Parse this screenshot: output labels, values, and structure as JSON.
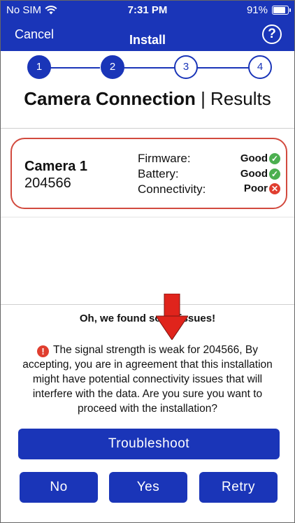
{
  "statusbar": {
    "carrier": "No SIM",
    "time": "7:31 PM",
    "battery": "91%"
  },
  "nav": {
    "cancel_label": "Cancel",
    "title": "Install",
    "help_label": "?"
  },
  "stepper": {
    "steps": [
      "1",
      "2",
      "3",
      "4"
    ],
    "active_step": 2
  },
  "screen": {
    "title_bold": "Camera Connection",
    "title_separator": " | ",
    "title_rest": "Results"
  },
  "camera": {
    "name": "Camera 1",
    "id": "204566",
    "metrics": [
      {
        "label": "Firmware:",
        "value": "Good",
        "ok": true
      },
      {
        "label": "Battery:",
        "value": "Good",
        "ok": true
      },
      {
        "label": "Connectivity:",
        "value": "Poor",
        "ok": false
      }
    ]
  },
  "issues": {
    "heading": "Oh, we found some issues!",
    "message": "The signal strength is weak for 204566,  By accepting, you are in agreement that this installation might have potential connectivity issues that will interfere with the data. Are you sure you want to proceed with the installation?"
  },
  "buttons": {
    "troubleshoot": "Troubleshoot",
    "no": "No",
    "yes": "Yes",
    "retry": "Retry"
  },
  "colors": {
    "primary": "#1a35b8",
    "danger": "#e03e2f",
    "success": "#4caf50",
    "card_border": "#d24a3e"
  }
}
